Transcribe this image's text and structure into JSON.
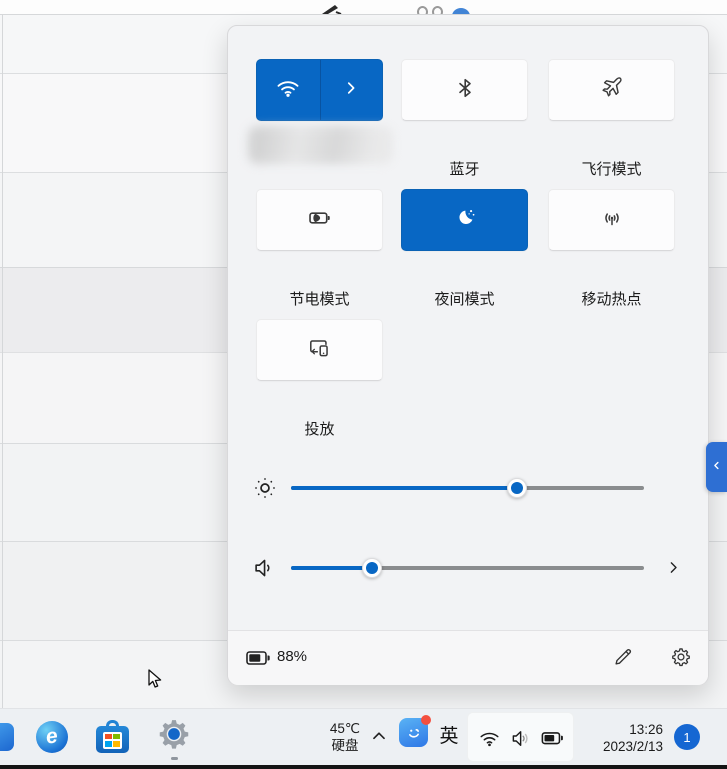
{
  "colors": {
    "accent": "#0867c4",
    "side_tab": "#2e6fd3",
    "badge_bg": "#1567d2"
  },
  "panel": {
    "tiles": [
      {
        "name": "wifi",
        "label": "",
        "active": true
      },
      {
        "name": "bluetooth",
        "label": "蓝牙",
        "active": false
      },
      {
        "name": "airplane-mode",
        "label": "飞行模式",
        "active": false
      },
      {
        "name": "battery-saver",
        "label": "节电模式",
        "active": false
      },
      {
        "name": "night-mode",
        "label": "夜间模式",
        "active": true
      },
      {
        "name": "mobile-hotspot",
        "label": "移动热点",
        "active": false
      },
      {
        "name": "cast",
        "label": "投放",
        "active": false
      }
    ],
    "sliders": {
      "brightness_percent": 64,
      "volume_percent": 23
    },
    "footer": {
      "battery_percent": "88%"
    }
  },
  "taskbar": {
    "tray": {
      "temperature": "45℃",
      "disk_label": "硬盘",
      "ime": "英"
    },
    "clock": {
      "time": "13:26",
      "date": "2023/2/13"
    },
    "notification_badge": "1"
  }
}
